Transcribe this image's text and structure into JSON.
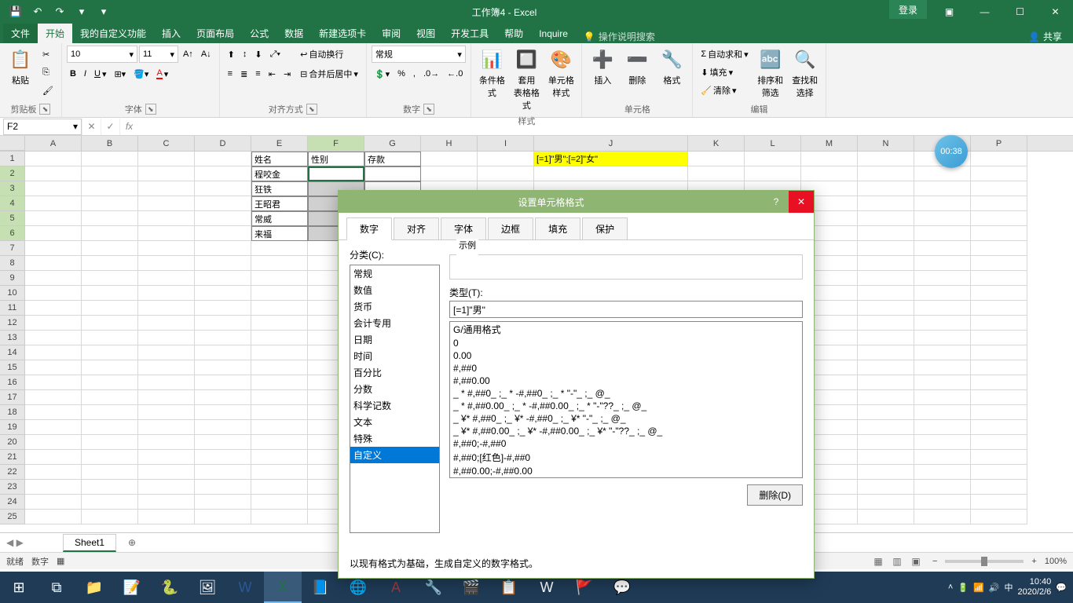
{
  "titlebar": {
    "title": "工作簿4 - Excel",
    "login": "登录"
  },
  "ribbon": {
    "tabs": [
      "文件",
      "开始",
      "我的自定义功能",
      "插入",
      "页面布局",
      "公式",
      "数据",
      "新建选项卡",
      "审阅",
      "视图",
      "开发工具",
      "帮助",
      "Inquire"
    ],
    "active_tab": "开始",
    "tell_me": "操作说明搜索",
    "share": "共享",
    "groups": {
      "clipboard": "剪贴板",
      "font": "字体",
      "alignment": "对齐方式",
      "number": "数字",
      "styles": "样式",
      "cells": "单元格",
      "editing": "编辑"
    },
    "font_name": "10",
    "font_size": "11",
    "number_format": "常规",
    "wrap_text": "自动换行",
    "merge_center": "合并后居中",
    "paste": "粘贴",
    "cond_fmt": "条件格式",
    "table_fmt": "套用\n表格格式",
    "cell_style": "单元格样式",
    "insert": "插入",
    "delete": "删除",
    "format": "格式",
    "autosum": "自动求和",
    "fill": "填充",
    "clear": "清除",
    "sort_filter": "排序和筛选",
    "find_select": "查找和选择"
  },
  "formula_bar": {
    "name_box": "F2",
    "formula": ""
  },
  "grid": {
    "cols": [
      "A",
      "B",
      "C",
      "D",
      "E",
      "F",
      "G",
      "H",
      "I",
      "J",
      "K",
      "L",
      "M",
      "N",
      "O",
      "P"
    ],
    "row_count": 25,
    "data": {
      "E1": "姓名",
      "F1": "性别",
      "G1": "存款",
      "E2": "程咬金",
      "E3": "狂铁",
      "E4": "王昭君",
      "E5": "常威",
      "E6": "来福",
      "J1": "[=1]\"男\";[=2]\"女\""
    }
  },
  "sheet_tabs": {
    "active": "Sheet1"
  },
  "status_bar": {
    "ready": "就绪",
    "mode": "数字",
    "zoom": "100%"
  },
  "dialog": {
    "title": "设置单元格格式",
    "tabs": [
      "数字",
      "对齐",
      "字体",
      "边框",
      "填充",
      "保护"
    ],
    "active_tab": "数字",
    "category_label": "分类(C):",
    "categories": [
      "常规",
      "数值",
      "货币",
      "会计专用",
      "日期",
      "时间",
      "百分比",
      "分数",
      "科学记数",
      "文本",
      "特殊",
      "自定义"
    ],
    "selected_category": "自定义",
    "sample_label": "示例",
    "sample_value": "",
    "type_label": "类型(T):",
    "type_value": "[=1]\"男\"",
    "formats": [
      "G/通用格式",
      "0",
      "0.00",
      "#,##0",
      "#,##0.00",
      "_ * #,##0_ ;_ * -#,##0_ ;_ * \"-\"_ ;_ @_",
      "_ * #,##0.00_ ;_ * -#,##0.00_ ;_ * \"-\"??_ ;_ @_",
      "_ ¥* #,##0_ ;_ ¥* -#,##0_ ;_ ¥* \"-\"_ ;_ @_",
      "_ ¥* #,##0.00_ ;_ ¥* -#,##0.00_ ;_ ¥* \"-\"??_ ;_ @_",
      "#,##0;-#,##0",
      "#,##0;[红色]-#,##0",
      "#,##0.00;-#,##0.00"
    ],
    "delete_btn": "删除(D)",
    "hint": "以现有格式为基础，生成自定义的数字格式。"
  },
  "timer": "00:38",
  "taskbar": {
    "time": "10:40",
    "date": "2020/2/6"
  }
}
